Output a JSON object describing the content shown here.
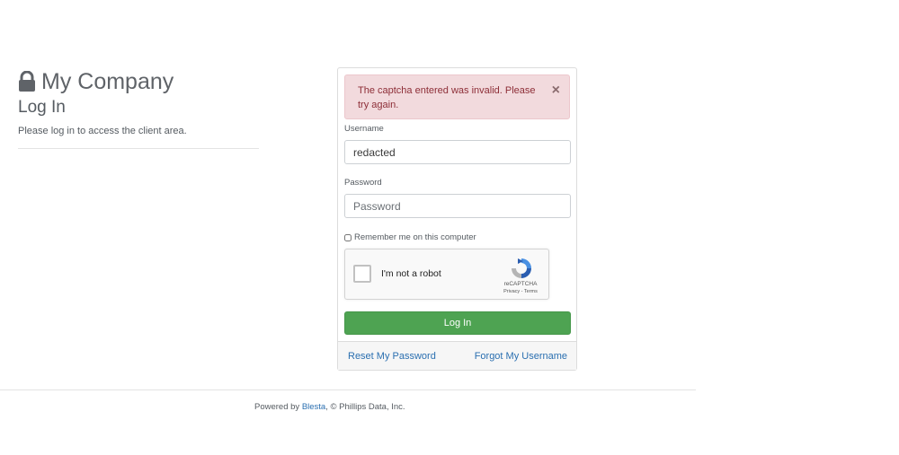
{
  "brand": {
    "company_name": "My Company",
    "lock_icon": "lock-icon"
  },
  "header": {
    "title": "Log In",
    "subtitle": "Please log in to access the client area."
  },
  "alert": {
    "message": "The captcha entered was invalid. Please try again.",
    "close_glyph": "×",
    "color": "#f2dadd"
  },
  "form": {
    "username": {
      "label": "Username",
      "value": "redacted"
    },
    "password": {
      "label": "Password",
      "placeholder": "Password",
      "value": ""
    },
    "remember_label": "Remember me on this computer",
    "remember_checked": false,
    "submit_label": "Log In",
    "submit_color": "#4ea352"
  },
  "recaptcha": {
    "label": "I'm not a robot",
    "brand": "reCAPTCHA",
    "privacy": "Privacy",
    "separator": " - ",
    "terms": "Terms"
  },
  "links": {
    "reset_password": "Reset My Password",
    "forgot_username": "Forgot My Username",
    "color": "#2a6fb0"
  },
  "footer": {
    "prefix": "Powered by ",
    "link_text": "Blesta",
    "suffix": ", © Phillips Data, Inc."
  }
}
